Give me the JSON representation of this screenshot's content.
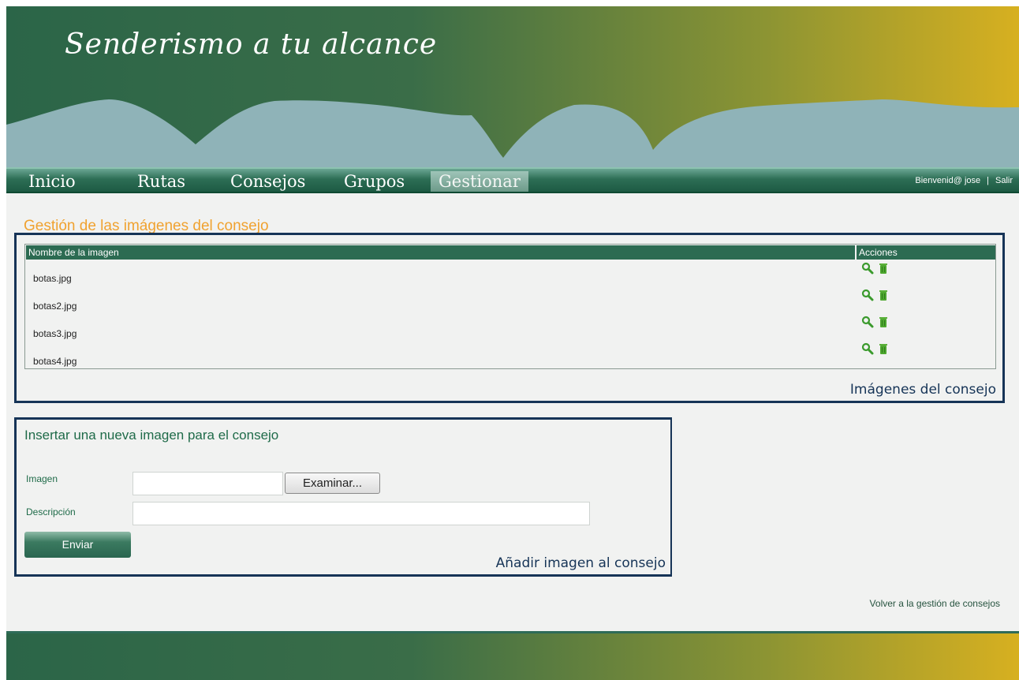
{
  "header": {
    "site_title": "Senderismo a tu alcance"
  },
  "nav": {
    "items": [
      {
        "label": "Inicio"
      },
      {
        "label": "Rutas"
      },
      {
        "label": "Consejos"
      },
      {
        "label": "Grupos"
      },
      {
        "label": "Gestionar"
      }
    ],
    "active": "Gestionar",
    "welcome": "Bienvenid@ jose",
    "separator": "|",
    "logout": "Salir"
  },
  "page": {
    "heading": "Gestión de las imágenes del consejo"
  },
  "images_table": {
    "columns": [
      "Nombre de la imagen",
      "Acciones"
    ],
    "rows": [
      {
        "name": "botas.jpg"
      },
      {
        "name": "botas2.jpg"
      },
      {
        "name": "botas3.jpg"
      },
      {
        "name": "botas4.jpg"
      }
    ],
    "legend": "Imágenes del consejo",
    "action_icons": [
      "magnifier-icon",
      "trash-icon"
    ]
  },
  "insert_form": {
    "title": "Insertar una nueva imagen para el consejo",
    "image_label": "Imagen",
    "browse_label": "Examinar...",
    "description_label": "Descripción",
    "submit_label": "Enviar",
    "legend": "Añadir imagen al consejo"
  },
  "back_link": "Volver a la gestión de consejos",
  "colors": {
    "accent_heading": "#f0a230",
    "brand_green": "#2c6b52",
    "legend_blue": "#163457"
  }
}
